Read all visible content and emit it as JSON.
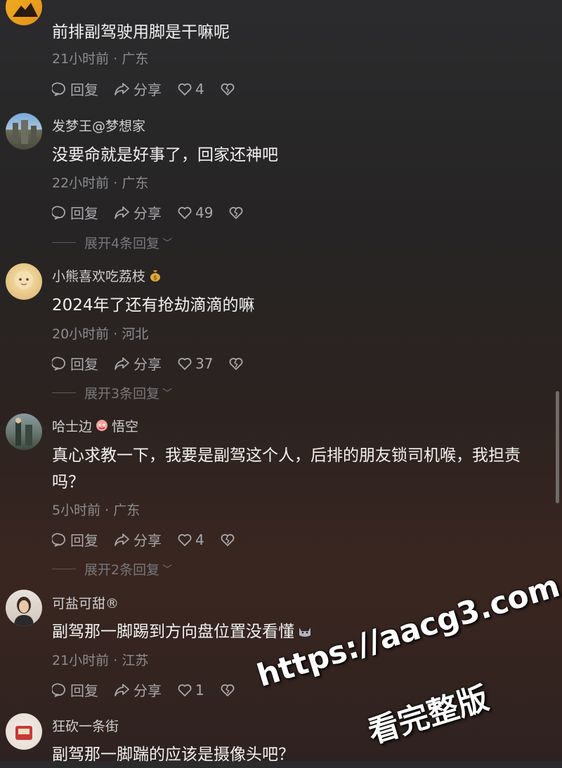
{
  "comments": [
    {
      "username": "",
      "text": "前排副驾驶用脚是干嘛呢",
      "time": "21小时前",
      "location": "广东",
      "likes": "4"
    },
    {
      "username": "发梦王@梦想家",
      "text": "没要命就是好事了，回家还神吧",
      "time": "22小时前",
      "location": "广东",
      "likes": "49",
      "expand_label": "展开4条回复"
    },
    {
      "username": "小熊喜欢吃荔枝",
      "text": "2024年了还有抢劫滴滴的嘛",
      "time": "20小时前",
      "location": "河北",
      "likes": "37",
      "expand_label": "展开3条回复"
    },
    {
      "username_part1": "哈士边",
      "username_part2": "悟空",
      "text": "真心求教一下，我要是副驾这个人，后排的朋友锁司机喉，我担责吗？",
      "time": "5小时前",
      "location": "广东",
      "likes": "4",
      "expand_label": "展开2条回复"
    },
    {
      "username": "可盐可甜®",
      "text": "副驾那一脚踢到方向盘位置没看懂",
      "time": "21小时前",
      "location": "江苏",
      "likes": "1"
    },
    {
      "username": "狂砍一条街",
      "text": "副驾那一脚踹的应该是摄像头吧？"
    }
  ],
  "labels": {
    "reply": "回复",
    "share": "分享",
    "dot": "·"
  },
  "watermark": {
    "line1": "https://aacg3.com",
    "line2": "看完整版"
  },
  "icons": [
    "comment-icon",
    "share-icon",
    "heart-icon",
    "broken-heart-icon",
    "chevron-down-icon",
    "money-bag-emoji",
    "mask-emoji",
    "cat-emoji"
  ]
}
